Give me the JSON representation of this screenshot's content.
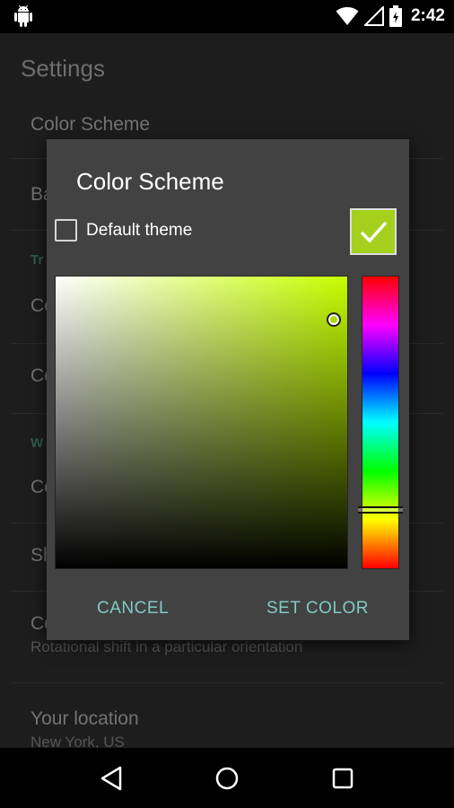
{
  "status_bar": {
    "time": "2:42"
  },
  "background": {
    "app_title": "Settings",
    "items": [
      {
        "title": "Color Scheme",
        "subtitle": ""
      },
      {
        "title": "Ba",
        "subtitle": ""
      },
      {
        "category": "Tr"
      },
      {
        "title": "Co",
        "subtitle": ""
      },
      {
        "title": "Co",
        "subtitle": ""
      },
      {
        "category": "W"
      },
      {
        "title": "Co",
        "subtitle": ""
      },
      {
        "title": "Sh",
        "subtitle": ""
      },
      {
        "title": "Co",
        "subtitle": "Rotational shift in a particular orientation"
      },
      {
        "title": "Your location",
        "subtitle": "New York, US"
      }
    ]
  },
  "dialog": {
    "title": "Color Scheme",
    "default_theme_label": "Default theme",
    "default_theme_checked": false,
    "hue_color": "#c6ff00",
    "selected_color": "#a4d11e",
    "cancel_label": "CANCEL",
    "set_color_label": "SET COLOR"
  },
  "icons": {
    "status": [
      "android-icon",
      "wifi-icon",
      "signal-icon",
      "battery-icon"
    ],
    "swatch": "check-icon",
    "nav": [
      "back-icon",
      "home-icon",
      "recents-icon"
    ]
  }
}
